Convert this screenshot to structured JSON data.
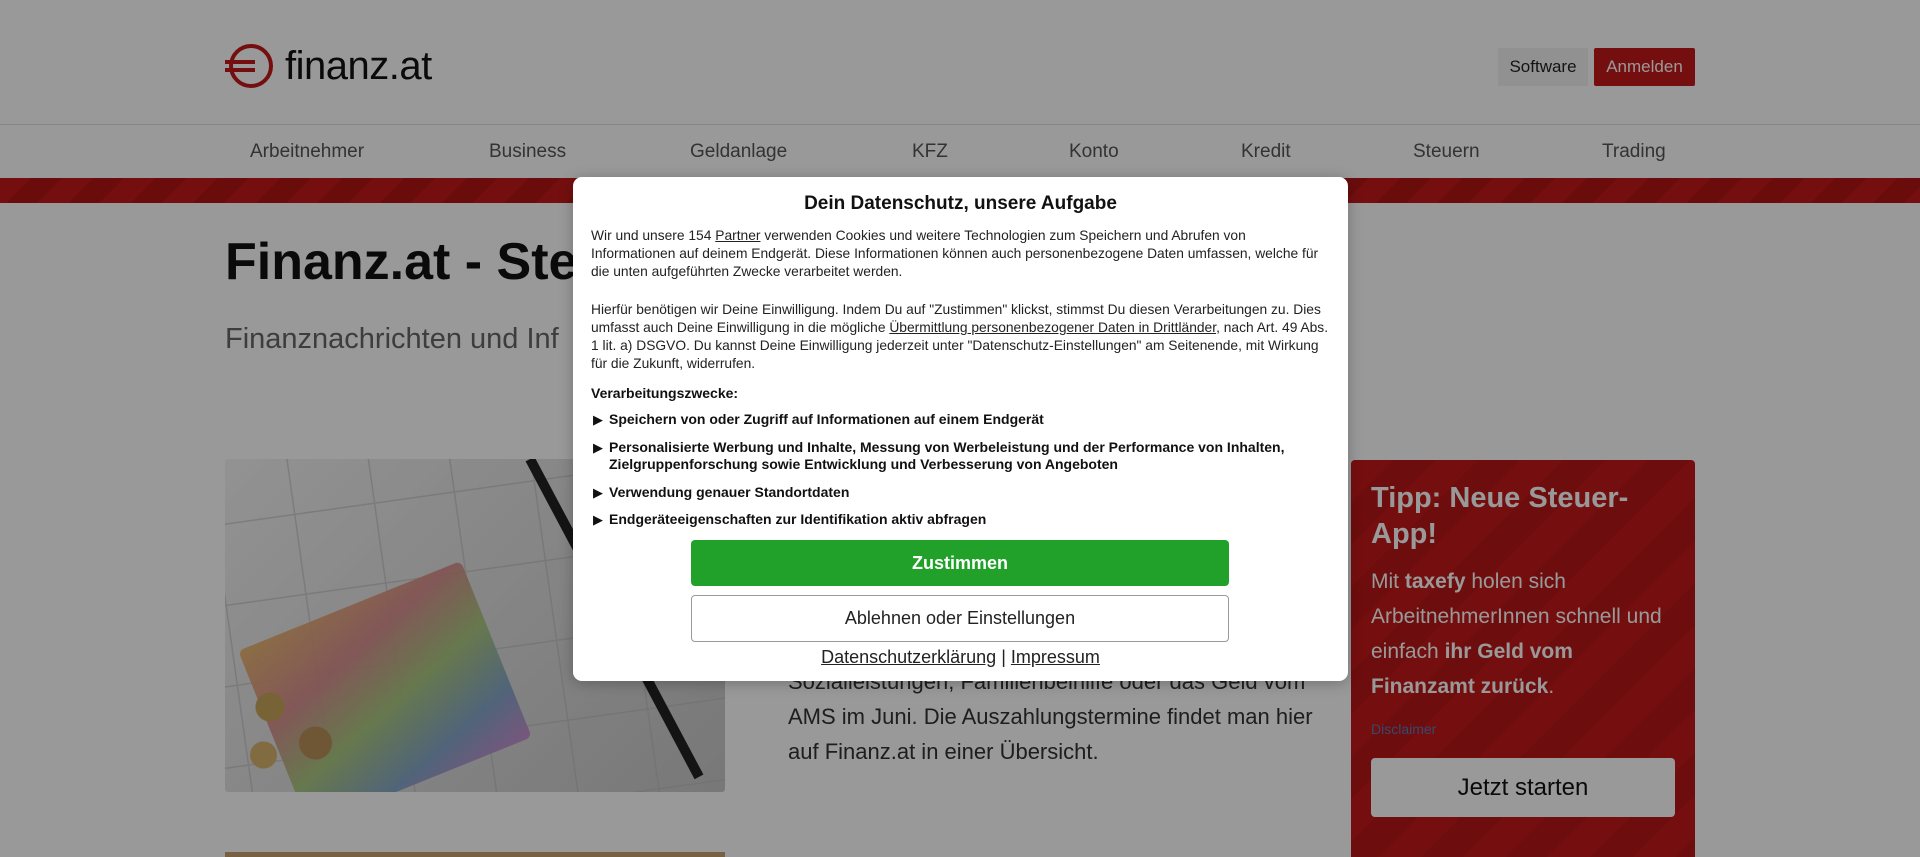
{
  "header": {
    "logo_text": "finanz.at",
    "software_label": "Software",
    "login_label": "Anmelden"
  },
  "nav": {
    "items": [
      {
        "label": "Arbeitnehmer"
      },
      {
        "label": "Business"
      },
      {
        "label": "Geldanlage"
      },
      {
        "label": "KFZ"
      },
      {
        "label": "Konto"
      },
      {
        "label": "Kredit"
      },
      {
        "label": "Steuern"
      },
      {
        "label": "Trading"
      }
    ]
  },
  "main": {
    "title": "Finanz.at - Steu",
    "subtitle": "Finanznachrichten und Inf",
    "article_text": "Sozialleistungen, Familienbeihilfe oder das Geld vom AMS im Juni. Die Auszahlungstermine findet man hier auf Finanz.at in einer Übersicht."
  },
  "aside": {
    "title": "Tipp: Neue Steuer-App!",
    "body_pre": "Mit ",
    "body_bold1": "taxefy",
    "body_mid": " holen sich ArbeitnehmerInnen schnell und einfach ",
    "body_bold2": "ihr Geld vom Finanzamt zurück",
    "body_post": ".",
    "disclaimer": "Disclaimer",
    "cta_label": "Jetzt starten"
  },
  "consent": {
    "title": "Dein Datenschutz, unsere Aufgabe",
    "p1_pre": "Wir und unsere 154 ",
    "p1_link": "Partner",
    "p1_post": " verwenden Cookies und weitere Technologien zum Speichern und Abrufen von Informationen auf deinem Endgerät. Diese Informationen können auch personenbezogene Daten umfassen, welche für die unten aufgeführten Zwecke verarbeitet werden.",
    "p2_pre": "Hierfür benötigen wir Deine Einwilligung. Indem Du auf \"Zustimmen\" klickst, stimmst Du diesen Verarbeitungen zu. Dies umfasst auch Deine Einwilligung in die mögliche ",
    "p2_link": "Übermittlung personenbezogener Daten in Drittländer",
    "p2_post": ", nach Art. 49 Abs. 1 lit. a) DSGVO. Du kannst Deine Einwilligung jederzeit unter \"Datenschutz-Einstellungen\" am Seitenende, mit Wirkung für die Zukunft, widerrufen.",
    "purposes_label": "Verarbeitungszwecke:",
    "purposes": [
      {
        "label": "Speichern von oder Zugriff auf Informationen auf einem Endgerät"
      },
      {
        "label": "Personalisierte Werbung und Inhalte, Messung von Werbeleistung und der Performance von Inhalten, Zielgruppenforschung sowie Entwicklung und Verbesserung von Angeboten"
      },
      {
        "label": "Verwendung genauer Standortdaten"
      },
      {
        "label": "Endgeräteeigenschaften zur Identifikation aktiv abfragen"
      }
    ],
    "accept_label": "Zustimmen",
    "reject_label": "Ablehnen oder Einstellungen",
    "privacy_link": "Datenschutzerklärung",
    "separator": "|",
    "imprint_link": "Impressum"
  },
  "colors": {
    "brand_red": "#c41a1a",
    "accept_green": "#21a12a"
  },
  "icons": {
    "logo": "euro-circle-logo-icon",
    "purpose_expander": "triangle-right-icon"
  }
}
